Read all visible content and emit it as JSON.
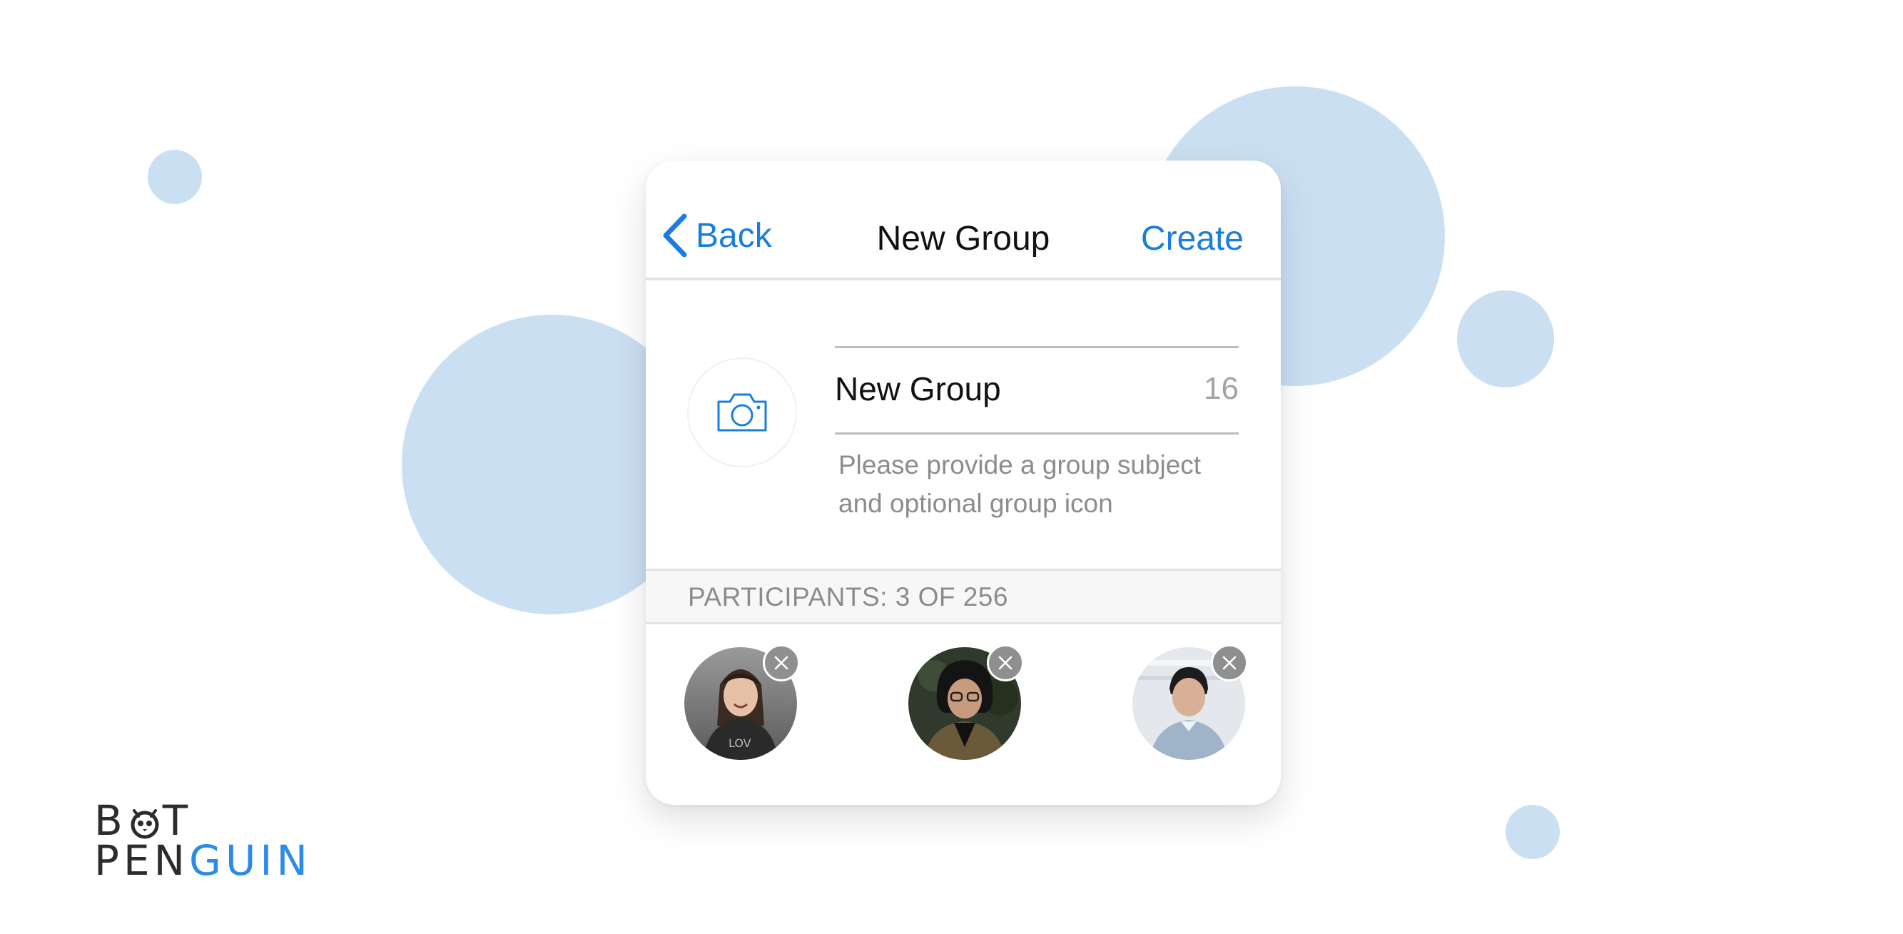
{
  "nav": {
    "back_label": "Back",
    "title": "New Group",
    "create_label": "Create"
  },
  "group": {
    "photo_icon": "camera-icon",
    "subject_value": "New Group",
    "char_count": "16",
    "helper_text": "Please provide a group subject and optional group icon"
  },
  "participants": {
    "header": "PARTICIPANTS: 3 OF 256",
    "members": [
      {
        "remove_icon": "close-icon"
      },
      {
        "remove_icon": "close-icon"
      },
      {
        "remove_icon": "close-icon"
      }
    ]
  },
  "logo": {
    "line1_start": "B",
    "line1_end": "T",
    "line2_dark": "PEN",
    "line2_accent": "GUIN",
    "accent_color": "#2a8be8"
  },
  "colors": {
    "accent": "#1a7de0",
    "bubble": "#cbdff3",
    "secondary_text": "#8c8c8c"
  }
}
